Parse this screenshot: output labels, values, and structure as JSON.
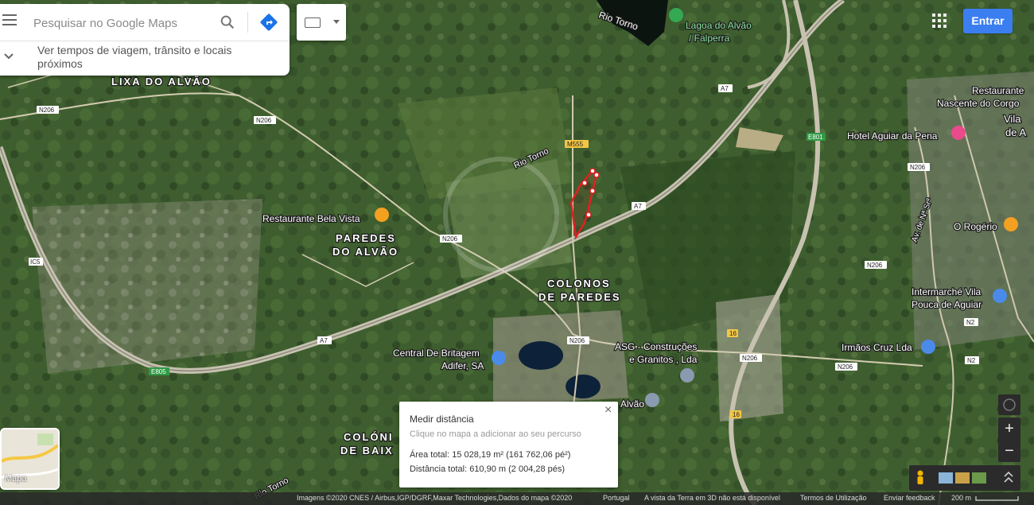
{
  "search": {
    "placeholder": "Pesquisar no Google Maps",
    "expand_text": "Ver tempos de viagem, trânsito e locais próximos"
  },
  "header": {
    "signin_label": "Entrar"
  },
  "layer_toggle": {
    "label": "Mapa"
  },
  "zoom": {
    "in_label": "+",
    "out_label": "−"
  },
  "measure_panel": {
    "title": "Medir distância",
    "hint": "Clique no mapa a adicionar ao seu percurso",
    "area": "Área total: 15 028,19 m² (161 762,06 pé²)",
    "distance": "Distância total: 610,90 m (2 004,28 pés)",
    "close": "×"
  },
  "footer": {
    "imagery": "Imagens ©2020 CNES / Airbus,IGP/DGRF,Maxar Technologies,Dados do mapa ©2020",
    "country": "Portugal",
    "notice": "A vista da Terra em 3D não está disponível",
    "terms": "Termos de Utilização",
    "feedback": "Enviar feedback",
    "scale": "200 m"
  },
  "map_labels": {
    "lixa": "LIXA DO ALVÃO",
    "paredes1": "PAREDES",
    "paredes2": "DO ALVÃO",
    "colonos1": "COLONOS",
    "colonos2": "DE PAREDES",
    "colonia1": "COLÓNI",
    "colonia2": "DE BAIX",
    "rio_torno_top": "Rio Torno",
    "rio_torno_mid": "Rio Torno",
    "rio_torno_bottom": "Rio Torno",
    "lagoa1": "Lagoa do Alvão",
    "lagoa2": "/ Falperra",
    "restaurante_bela_vista": "Restaurante Bela Vista",
    "restaurante_nascente1": "Restaurante",
    "restaurante_nascente2": "Nascente do Corgo",
    "hotel": "Hotel Aguiar da Pena",
    "vila1": "Vila",
    "vila2": "de A",
    "o_rogerio": "O Rogério",
    "intermarche1": "Intermarché Vila",
    "intermarche2": "Pouca de Aguiar",
    "central1": "Central De Britagem",
    "central2": "Adifer, SA",
    "asg1": "ASG - Construções",
    "asg2": "e Granitos , Lda",
    "alvao": "Alvão",
    "irmaos_cruz": "Irmãos Cruz Lda",
    "av_street": "Av. de Nª Srª"
  },
  "road_signs": {
    "n206": "N206",
    "a7": "A7",
    "m555": "M555",
    "ic5": "IC5",
    "e805": "E805",
    "e801": "E801",
    "n2": "N2",
    "r16": "16"
  },
  "colors": {
    "accent": "#3a7ef0",
    "measure_line": "#e02020",
    "pin_orange": "#f4a020",
    "pin_blue": "#4a8ae8",
    "pin_green": "#34a853",
    "pin_pink": "#e84a8a",
    "pin_grey": "#8a9ab0"
  }
}
